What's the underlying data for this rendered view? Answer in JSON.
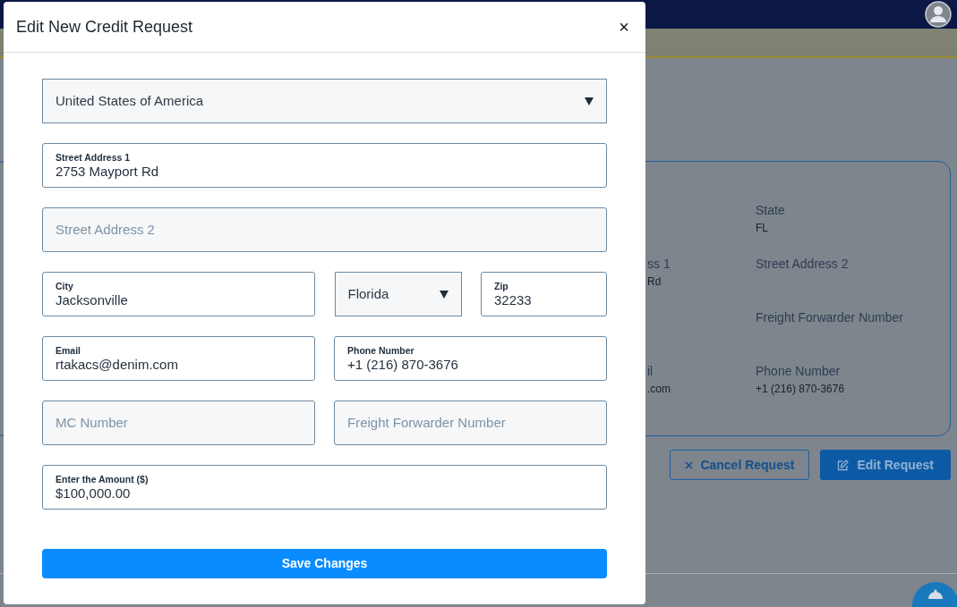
{
  "background": {
    "card": {
      "columns": [
        {
          "items": [
            {
              "label": "ss 1",
              "value": "Rd"
            },
            {
              "label": "il",
              "value": ".com"
            }
          ]
        },
        {
          "items": [
            {
              "label": "State",
              "value": "FL"
            },
            {
              "label": "Street Address 2",
              "value": ""
            },
            {
              "label": "Freight Forwarder Number",
              "value": ""
            },
            {
              "label": "Phone Number",
              "value": "+1 (216) 870-3676"
            }
          ]
        }
      ]
    },
    "buttons": [
      {
        "kind": "outline",
        "label": "Cancel Request"
      },
      {
        "kind": "solid",
        "label": "Edit Request"
      }
    ]
  },
  "modal": {
    "title": "Edit New Credit Request",
    "close": "×",
    "rows": [
      [
        {
          "kind": "select",
          "value": "United States of America"
        }
      ],
      [
        {
          "kind": "input",
          "label": "Street Address 1",
          "value": "2753 Mayport Rd"
        }
      ],
      [
        {
          "kind": "input",
          "placeholder": "Street Address 2"
        }
      ],
      [
        {
          "kind": "input",
          "label": "City",
          "value": "Jacksonville"
        },
        {
          "kind": "select",
          "value": "Florida"
        },
        {
          "kind": "input",
          "label": "Zip",
          "value": "32233"
        }
      ],
      [
        {
          "kind": "input",
          "label": "Email",
          "value": "rtakacs@denim.com"
        },
        {
          "kind": "input",
          "label": "Phone Number",
          "value": "+1 (216) 870-3676"
        }
      ],
      [
        {
          "kind": "input",
          "placeholder": "MC Number"
        },
        {
          "kind": "input",
          "placeholder": "Freight Forwarder Number"
        }
      ],
      [
        {
          "kind": "input",
          "label": "Enter the Amount ($)",
          "value": "$100,000.00"
        }
      ]
    ],
    "submit": "Save Changes"
  }
}
